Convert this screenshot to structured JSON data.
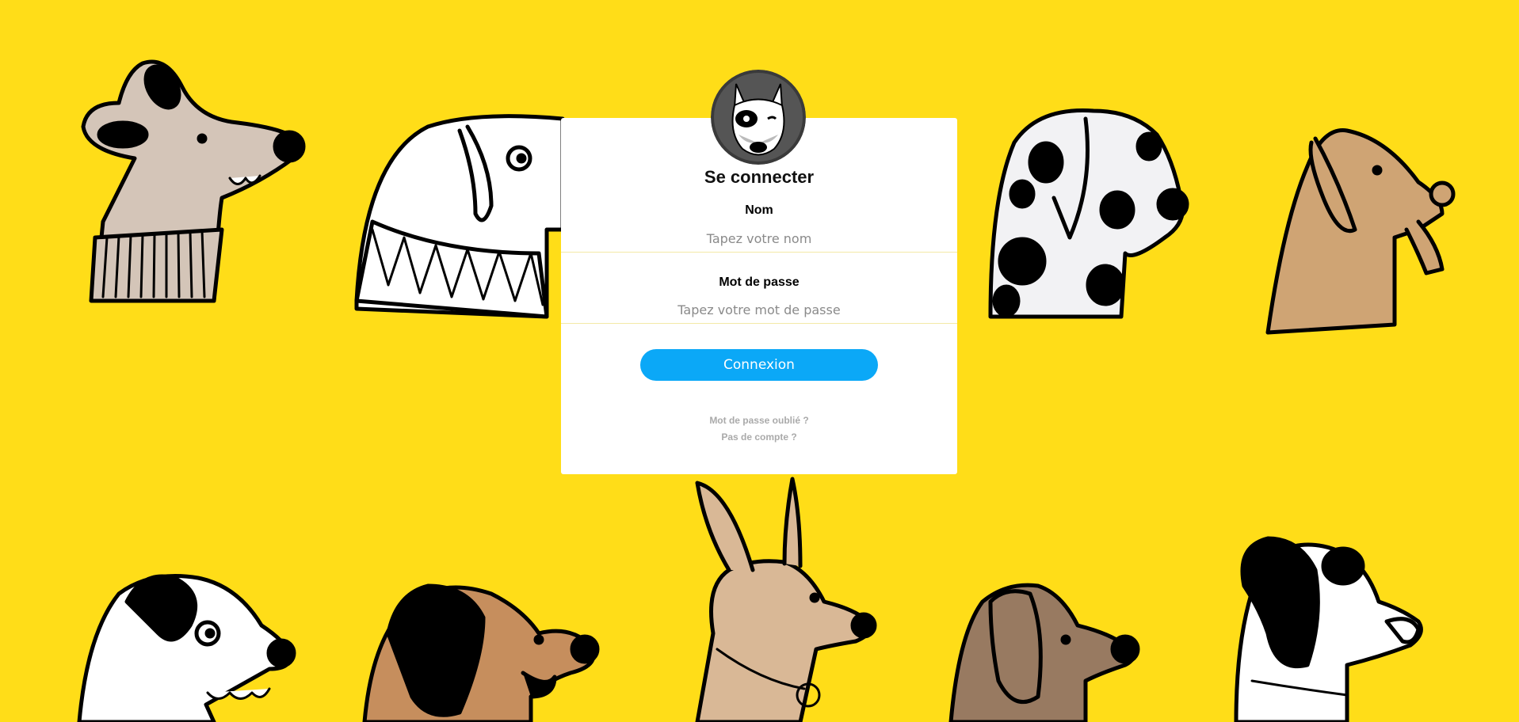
{
  "login": {
    "title": "Se connecter",
    "name_label": "Nom",
    "name_placeholder": "Tapez votre nom",
    "name_value": "",
    "password_label": "Mot de passe",
    "password_placeholder": "Tapez votre mot de passe",
    "password_value": "",
    "submit_label": "Connexion",
    "forgot_password_link": "Mot de passe oublié ?",
    "no_account_link": "Pas de compte ?"
  },
  "icons": {
    "avatar": "dog-avatar-icon"
  },
  "colors": {
    "background": "#FFDD18",
    "button": "#0BA8F7",
    "card": "#FFFFFF",
    "link": "#AAAAAA"
  }
}
